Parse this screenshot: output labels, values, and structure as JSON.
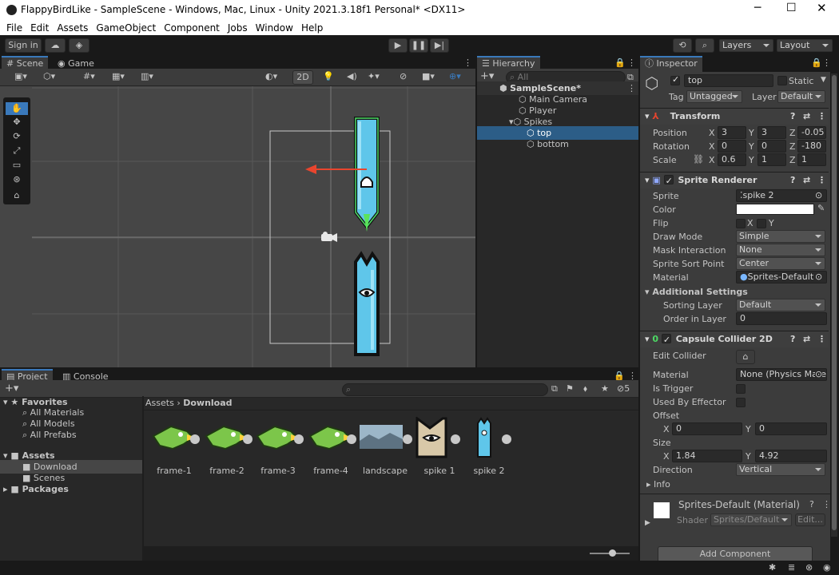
{
  "window": {
    "title": "FlappyBirdLike - SampleScene - Windows, Mac, Linux - Unity 2021.3.18f1 Personal* <DX11>"
  },
  "menu": [
    "File",
    "Edit",
    "Assets",
    "GameObject",
    "Component",
    "Jobs",
    "Window",
    "Help"
  ],
  "toolbar": {
    "signin": "Sign in",
    "layers": "Layers",
    "layout": "Layout"
  },
  "scene": {
    "tab_scene": "Scene",
    "tab_game": "Game",
    "btn_2d": "2D"
  },
  "hierarchy": {
    "tab": "Hierarchy",
    "search_placeholder": "All",
    "scene_name": "SampleScene*",
    "items": [
      "Main Camera",
      "Player",
      "Spikes",
      "top",
      "bottom"
    ]
  },
  "inspector": {
    "tab": "Inspector",
    "object_name": "top",
    "static_label": "Static",
    "tag_label": "Tag",
    "tag_value": "Untagged",
    "layer_label": "Layer",
    "layer_value": "Default",
    "transform": {
      "title": "Transform",
      "position_label": "Position",
      "position": [
        "3",
        "3",
        "-0.05"
      ],
      "rotation_label": "Rotation",
      "rotation": [
        "0",
        "0",
        "-180"
      ],
      "scale_label": "Scale",
      "scale": [
        "0.6",
        "1",
        "1"
      ]
    },
    "sprite_renderer": {
      "title": "Sprite Renderer",
      "sprite_label": "Sprite",
      "sprite": "spike 2",
      "color_label": "Color",
      "flip_label": "Flip",
      "flip_x": "X",
      "flip_y": "Y",
      "draw_mode_label": "Draw Mode",
      "draw_mode": "Simple",
      "mask_label": "Mask Interaction",
      "mask": "None",
      "sort_point_label": "Sprite Sort Point",
      "sort_point": "Center",
      "material_label": "Material",
      "material": "Sprites-Default",
      "additional": "Additional Settings",
      "sorting_layer_label": "Sorting Layer",
      "sorting_layer": "Default",
      "order_label": "Order in Layer",
      "order": "0"
    },
    "capsule": {
      "title": "Capsule Collider 2D",
      "edit_label": "Edit Collider",
      "material_label": "Material",
      "material": "None (Physics Mate",
      "trigger_label": "Is Trigger",
      "effector_label": "Used By Effector",
      "offset_label": "Offset",
      "offset": [
        "0",
        "0"
      ],
      "size_label": "Size",
      "size": [
        "1.84",
        "4.92"
      ],
      "direction_label": "Direction",
      "direction": "Vertical",
      "info_label": "Info"
    },
    "material_preview": {
      "name": "Sprites-Default (Material)",
      "shader_label": "Shader",
      "shader": "Sprites/Default",
      "edit": "Edit..."
    },
    "add_component": "Add Component"
  },
  "project": {
    "tab_project": "Project",
    "tab_console": "Console",
    "hidden_count": "5",
    "favorites": "Favorites",
    "fav_items": [
      "All Materials",
      "All Models",
      "All Prefabs"
    ],
    "assets": "Assets",
    "asset_folders": [
      "Download",
      "Scenes"
    ],
    "packages": "Packages",
    "breadcrumb_root": "Assets",
    "breadcrumb_current": "Download",
    "files": [
      "frame-1",
      "frame-2",
      "frame-3",
      "frame-4",
      "landscape",
      "spike 1",
      "spike 2"
    ]
  },
  "colors": {
    "accent": "#3a79bb",
    "selection": "#2c5d87",
    "sprite_blue": "#5fc6ea"
  }
}
